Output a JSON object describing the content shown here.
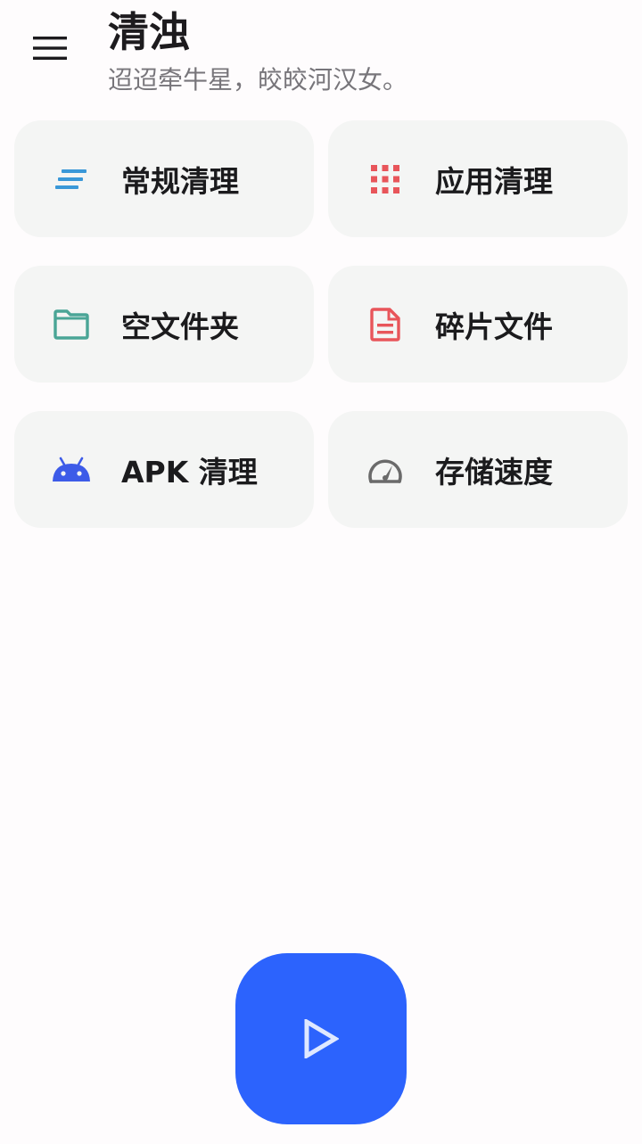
{
  "header": {
    "title": "清浊",
    "subtitle": "迢迢牵牛星，皎皎河汉女。"
  },
  "cards": [
    {
      "label": "常规清理",
      "icon": "lines-icon",
      "color": "#3a98d8"
    },
    {
      "label": "应用清理",
      "icon": "apps-grid-icon",
      "color": "#e8555a"
    },
    {
      "label": "空文件夹",
      "icon": "folder-icon",
      "color": "#4aa596"
    },
    {
      "label": "碎片文件",
      "icon": "document-icon",
      "color": "#e8555a"
    },
    {
      "label": "APK 清理",
      "icon": "android-icon",
      "color": "#3d5be8"
    },
    {
      "label": "存储速度",
      "icon": "speedometer-icon",
      "color": "#6a6a6a"
    }
  ],
  "fab": {
    "icon": "play-icon",
    "color": "#2c63fd"
  }
}
